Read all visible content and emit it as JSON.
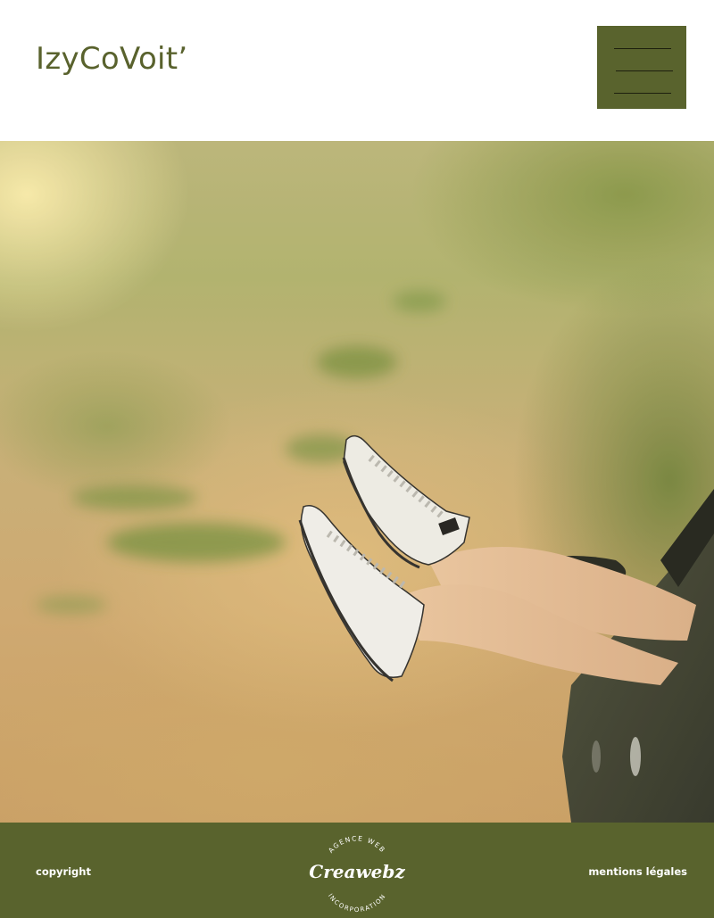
{
  "header": {
    "brand": "IzyCoVoit’",
    "menu_icon": "hamburger-menu-icon"
  },
  "hero": {
    "image_subject": "legs-with-white-sneakers-out-of-car-window"
  },
  "footer": {
    "copyright_label": "copyright",
    "legal_label": "mentions légales",
    "logo": {
      "top_text": "AGENCE WEB",
      "main_text": "Creawebz",
      "bottom_text": "INCORPORATION"
    }
  },
  "colors": {
    "olive": "#59632d",
    "brand_text": "#59622d",
    "background": "#ffffff"
  }
}
